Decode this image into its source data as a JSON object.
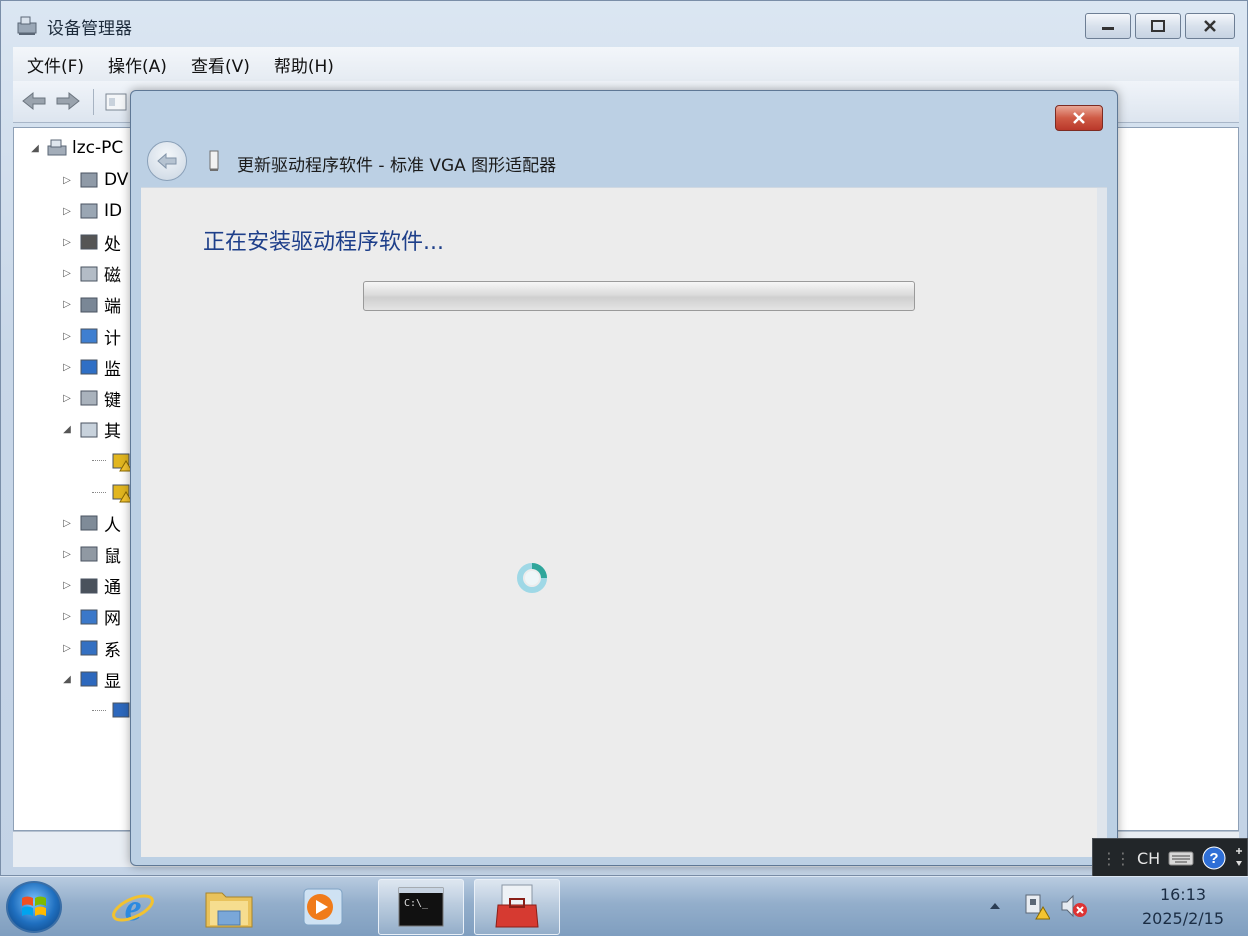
{
  "window": {
    "title": "设备管理器",
    "minimize_icon": "minimize-icon",
    "maximize_icon": "maximize-icon",
    "close_icon": "close-icon"
  },
  "menu": [
    "文件(F)",
    "操作(A)",
    "查看(V)",
    "帮助(H)"
  ],
  "tree": {
    "root": "lzc-PC",
    "items": [
      {
        "label": "DV",
        "icon": "dvd-drive-icon",
        "expanded": false
      },
      {
        "label": "ID",
        "icon": "ide-controller-icon",
        "expanded": false
      },
      {
        "label": "处",
        "icon": "processor-icon",
        "expanded": false
      },
      {
        "label": "磁",
        "icon": "disk-drive-icon",
        "expanded": false
      },
      {
        "label": "端",
        "icon": "port-icon",
        "expanded": false
      },
      {
        "label": "计",
        "icon": "computer-icon",
        "expanded": false
      },
      {
        "label": "监",
        "icon": "monitor-icon",
        "expanded": false
      },
      {
        "label": "键",
        "icon": "keyboard-icon",
        "expanded": false
      },
      {
        "label": "其",
        "icon": "unknown-device-icon",
        "expanded": true
      },
      {
        "label": "",
        "icon": "warning-device-icon",
        "child": true
      },
      {
        "label": "",
        "icon": "warning-device-icon",
        "child": true
      },
      {
        "label": "人",
        "icon": "hid-icon",
        "expanded": false
      },
      {
        "label": "鼠",
        "icon": "mouse-icon",
        "expanded": false
      },
      {
        "label": "通",
        "icon": "usb-icon",
        "expanded": false
      },
      {
        "label": "网",
        "icon": "network-adapter-icon",
        "expanded": false
      },
      {
        "label": "系",
        "icon": "system-device-icon",
        "expanded": false
      },
      {
        "label": "显",
        "icon": "display-adapter-icon",
        "expanded": true
      },
      {
        "label": "",
        "icon": "display-adapter-icon",
        "child": true
      }
    ]
  },
  "dialog": {
    "title": "更新驱动程序软件 - 标准 VGA 图形适配器",
    "status": "正在安装驱动程序软件...",
    "progress": 0,
    "colors": {
      "status_text": "#1e3f8a"
    }
  },
  "langbar": {
    "lang": "CH"
  },
  "taskbar": {
    "time": "16:13",
    "date": "2025/2/15",
    "pinned": [
      "ie-icon",
      "explorer-icon",
      "media-player-icon",
      "cmd-icon",
      "device-manager-icon"
    ]
  }
}
